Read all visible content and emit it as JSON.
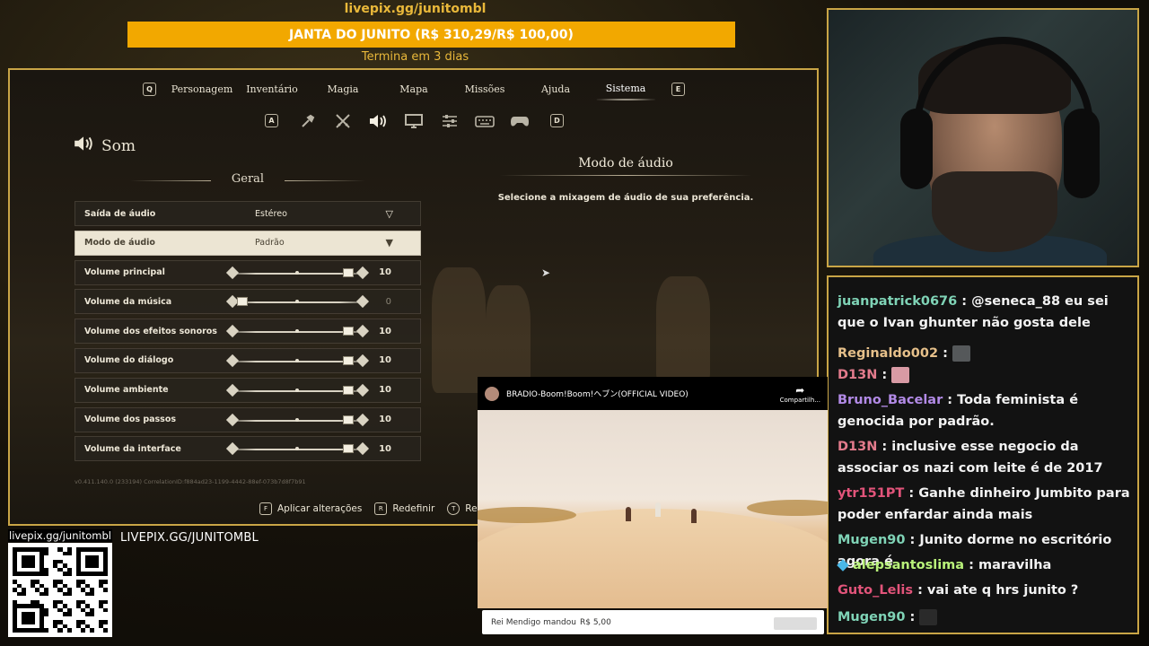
{
  "donation": {
    "url": "livepix.gg/junitombl",
    "goal": "JANTA DO JUNITO (R$ 310,29/R$ 100,00)",
    "ends": "Termina em 3 dias"
  },
  "game": {
    "nav": {
      "left_key": "Q",
      "right_key": "E",
      "items": [
        "Personagem",
        "Inventário",
        "Magia",
        "Mapa",
        "Missões",
        "Ajuda",
        "Sistema"
      ],
      "active": "Sistema"
    },
    "category_keys": {
      "left": "A",
      "right": "D"
    },
    "category_icons": [
      "torch-icon",
      "swords-icon",
      "speaker-icon",
      "monitor-icon",
      "sliders-icon",
      "keyboard-icon",
      "gamepad-icon"
    ],
    "section_title": "Som",
    "group_title": "Geral",
    "rows": [
      {
        "label": "Saída de áudio",
        "type": "dropdown",
        "value": "Estéreo"
      },
      {
        "label": "Modo de áudio",
        "type": "dropdown",
        "value": "Padrão",
        "selected": true
      },
      {
        "label": "Volume principal",
        "type": "slider",
        "value": "10",
        "level": 10
      },
      {
        "label": "Volume da música",
        "type": "slider",
        "value": "0",
        "level": 0
      },
      {
        "label": "Volume dos efeitos sonoros",
        "type": "slider",
        "value": "10",
        "level": 10
      },
      {
        "label": "Volume do diálogo",
        "type": "slider",
        "value": "10",
        "level": 10
      },
      {
        "label": "Volume ambiente",
        "type": "slider",
        "value": "10",
        "level": 10
      },
      {
        "label": "Volume dos passos",
        "type": "slider",
        "value": "10",
        "level": 10
      },
      {
        "label": "Volume da interface",
        "type": "slider",
        "value": "10",
        "level": 10
      }
    ],
    "version": "v0.411.140.0 (233194) CorrelationID:f884ad23-1199-4442-88ef-073b7d8f7b91",
    "footer": {
      "apply_key": "F",
      "apply_label": "Aplicar alterações",
      "reset_key": "R",
      "reset_label": "Redefinir",
      "reset_all_key": "T",
      "reset_all_label": "Redefi"
    },
    "detail": {
      "title": "Modo de áudio",
      "description": "Selecione a mixagem de áudio de sua preferência."
    }
  },
  "chat": {
    "messages": [
      {
        "user": "juanpatrick0676",
        "color": "#7fd3b6",
        "text": "@seneca_88 eu sei que o Ivan ghunter não gosta dele"
      },
      {
        "user": "Reginaldo002",
        "color": "#e6c08a",
        "text": "",
        "emote": "#55585a"
      },
      {
        "user": "D13N",
        "color": "#e37b8c",
        "text": "",
        "emote": "#d89aa4"
      },
      {
        "user": "Bruno_Bacelar",
        "color": "#b28ae6",
        "text": "Toda feminista é genocida por padrão."
      },
      {
        "user": "D13N",
        "color": "#e37b8c",
        "text": "inclusive esse negocio da associar os nazi com leite é de 2017"
      },
      {
        "user": "ytr151PT",
        "color": "#e2547a",
        "text": "Ganhe dinheiro Jumbito para poder enfardar ainda mais"
      },
      {
        "user": "Mugen90",
        "color": "#7fd3b6",
        "text": "Junito dorme no escritório agora é"
      },
      {
        "user": "alepsantoslima",
        "color": "#b9f27a",
        "text": "maravilha",
        "badge": true
      },
      {
        "user": "Guto_Lelis",
        "color": "#e2547a",
        "text": "vai ate q hrs junito ?"
      },
      {
        "user": "Mugen90",
        "color": "#7fd3b6",
        "text": "",
        "emote": "#2a2a2a"
      }
    ]
  },
  "qr": {
    "label": "livepix.gg/junitombl"
  },
  "stream_url": "LIVEPIX.GG/JUNITOMBL",
  "video": {
    "title": "BRADIO-Boom!Boom!ヘブン(OFFICIAL VIDEO)",
    "share": "Compartilh..."
  },
  "alert": {
    "name": "Rei Mendigo",
    "action": "mandou",
    "amount": "R$ 5,00"
  },
  "colors": {
    "frame_gold": "#c9a546",
    "goal_bar": "#f2a800"
  }
}
